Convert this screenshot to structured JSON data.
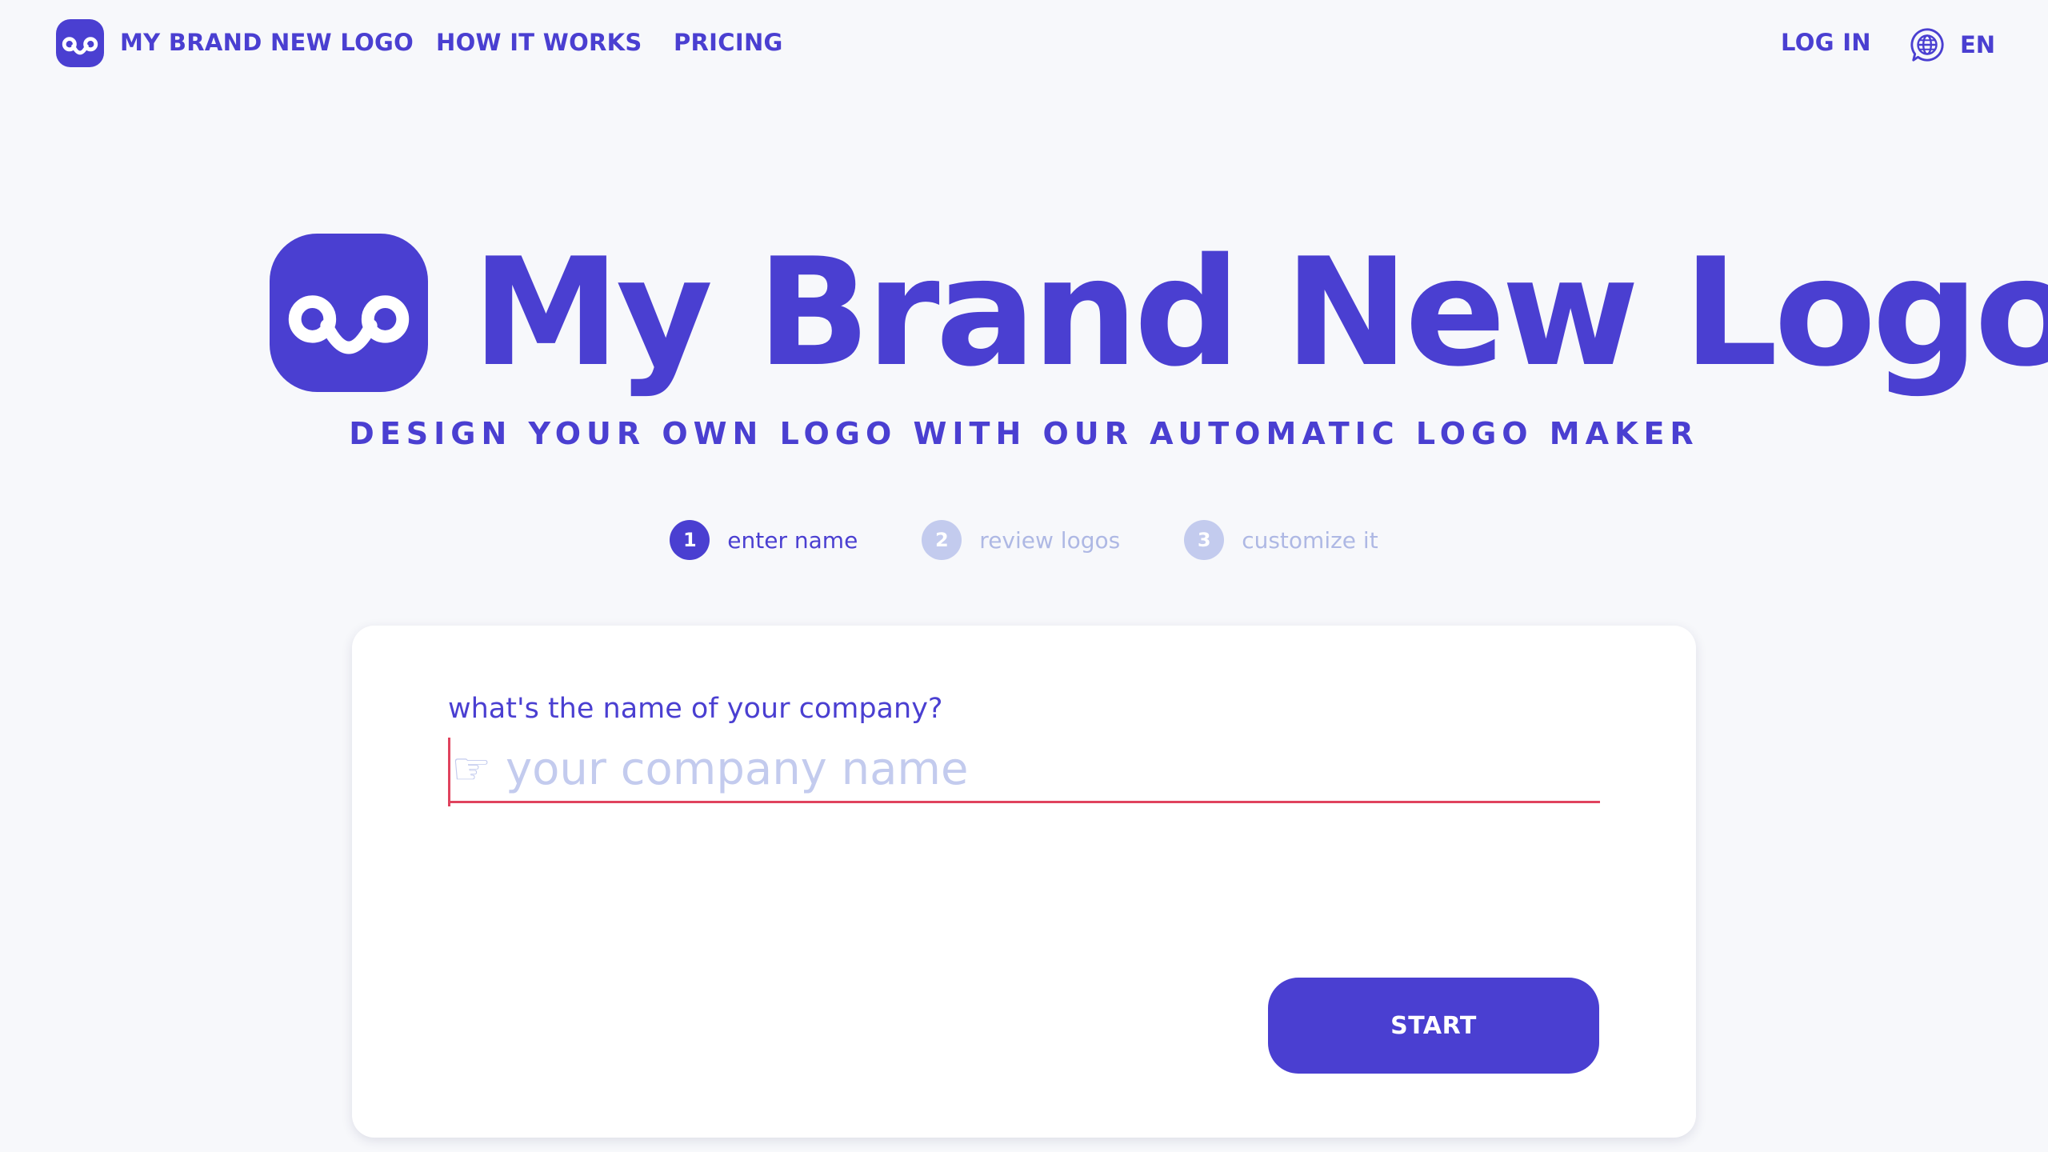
{
  "nav": {
    "brand_label": "MY BRAND NEW LOGO",
    "how_it_works_label": "HOW IT WORKS",
    "pricing_label": "PRICING",
    "login_label": "LOG IN",
    "language_label": "EN"
  },
  "hero": {
    "title": "My Brand New Logo",
    "subtitle": "DESIGN YOUR OWN LOGO WITH OUR AUTOMATIC LOGO MAKER"
  },
  "steps": [
    {
      "number": "1",
      "label": "enter name",
      "state": "active"
    },
    {
      "number": "2",
      "label": "review logos",
      "state": "inactive"
    },
    {
      "number": "3",
      "label": "customize it",
      "state": "inactive"
    }
  ],
  "form": {
    "question": "what's the name of your company?",
    "placeholder": "☞ your company name",
    "value": "",
    "start_label": "START"
  },
  "icons": {
    "brand": "monkey-face-logo-icon",
    "language": "globe-chat-icon"
  },
  "colors": {
    "brand": "#4a3fd1",
    "inactive": "#c3cbee",
    "input_underline": "#e0435e",
    "background": "#f7f8fb",
    "card": "#ffffff"
  }
}
